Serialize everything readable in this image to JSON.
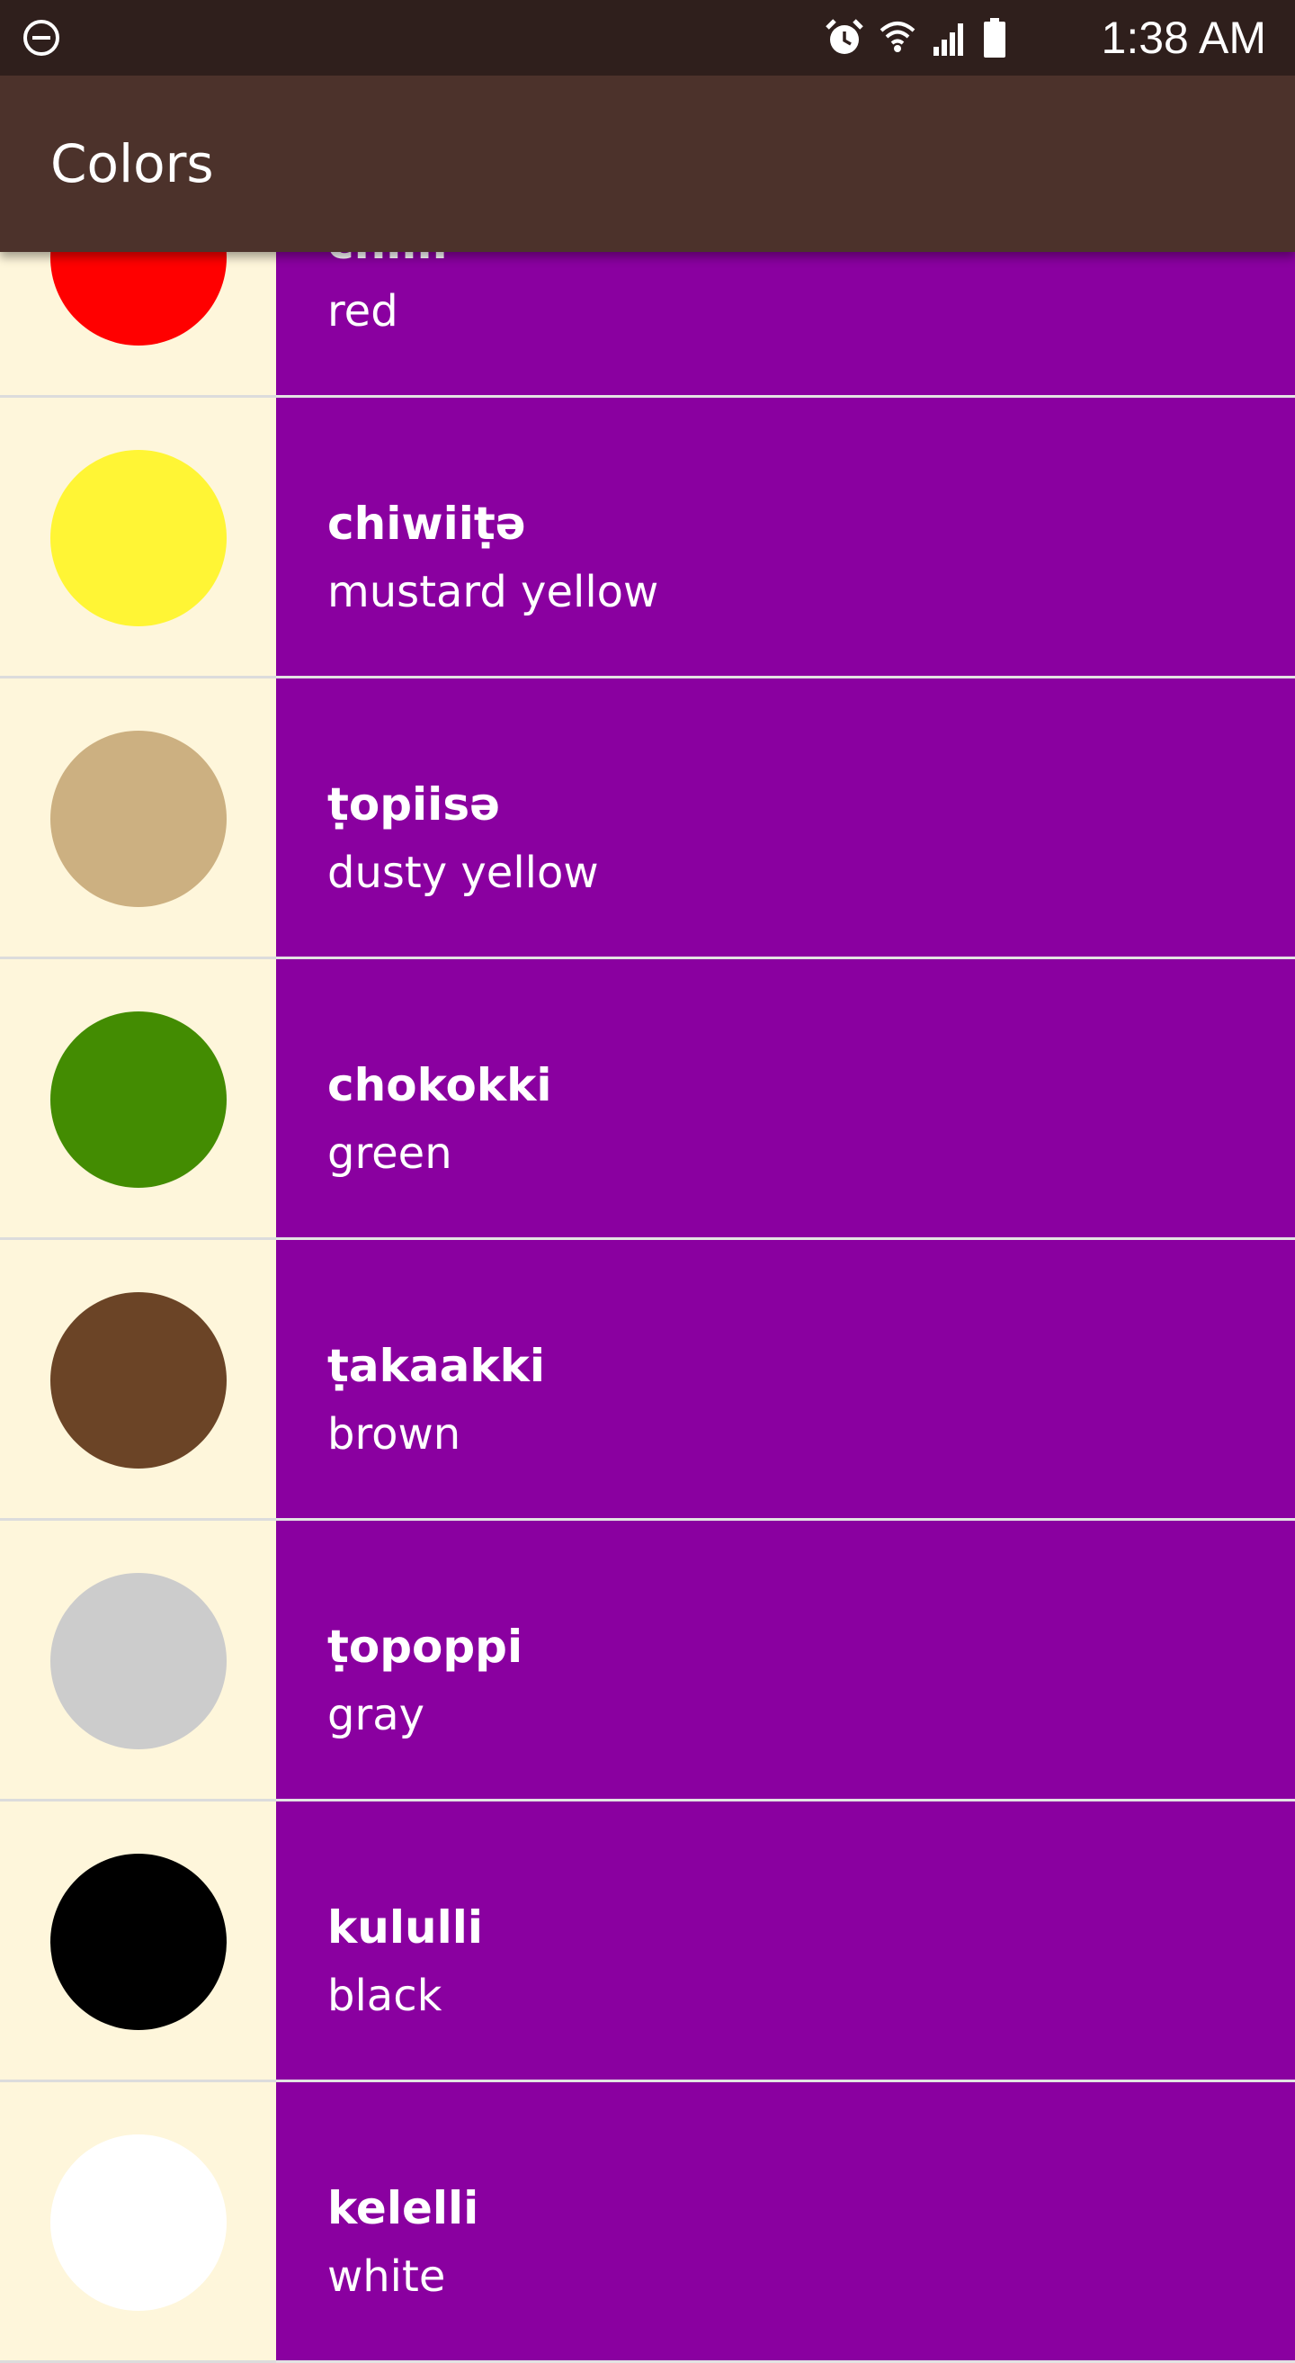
{
  "status_bar": {
    "time": "1:38 AM",
    "icons": [
      "do-not-disturb-icon",
      "alarm-icon",
      "wifi-icon",
      "signal-icon",
      "battery-icon"
    ]
  },
  "app_bar": {
    "title": "Colors"
  },
  "colors": {
    "background": "#FEF6DB",
    "panel": "#8A00A0",
    "app_bar": "#4C322B",
    "status_bar": "#2F1F1C"
  },
  "items": [
    {
      "word": "chilli",
      "meaning": "red",
      "swatch": "#FF0000"
    },
    {
      "word": "chiwiiṭə",
      "meaning": "mustard yellow",
      "swatch": "#FFF535"
    },
    {
      "word": "ṭopiisə",
      "meaning": "dusty yellow",
      "swatch": "#CCB081"
    },
    {
      "word": "chokokki",
      "meaning": "green",
      "swatch": "#438C02"
    },
    {
      "word": "ṭakaakki",
      "meaning": "brown",
      "swatch": "#6B4426"
    },
    {
      "word": "ṭopoppi",
      "meaning": "gray",
      "swatch": "#CCCCCC"
    },
    {
      "word": "kululli",
      "meaning": "black",
      "swatch": "#000000"
    },
    {
      "word": "kelelli",
      "meaning": "white",
      "swatch": "#FFFFFF"
    }
  ]
}
